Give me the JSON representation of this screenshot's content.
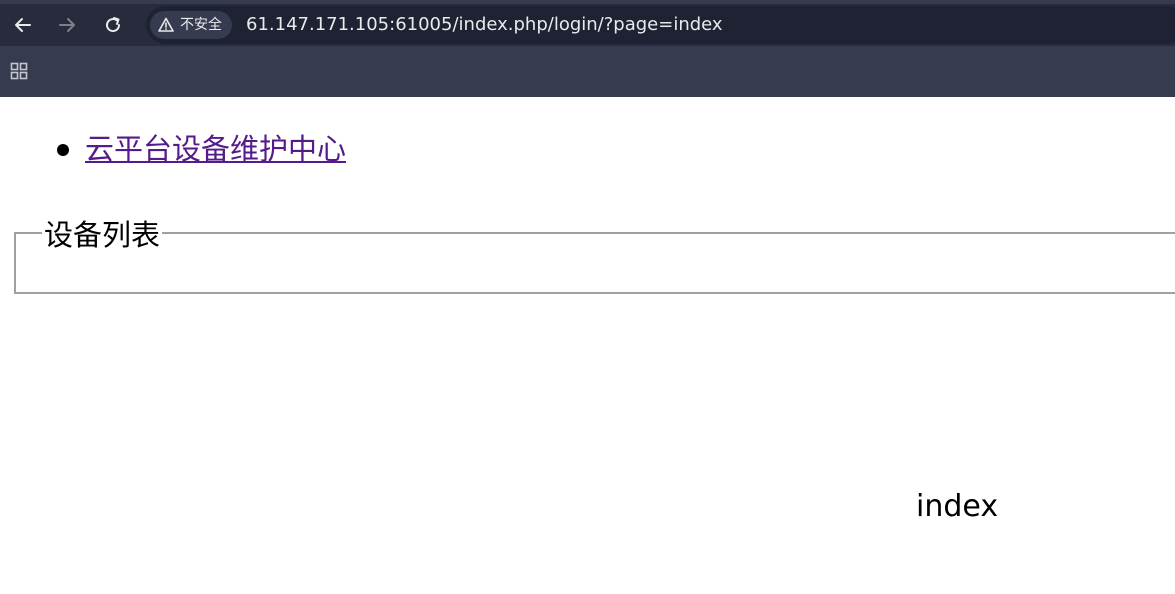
{
  "browser": {
    "security_label": "不安全",
    "url": "61.147.171.105:61005/index.php/login/?page=index",
    "icons": {
      "back": "arrow-left-icon",
      "forward": "arrow-right-icon",
      "reload": "reload-icon",
      "security": "warning-triangle-icon",
      "apps": "apps-grid-icon"
    },
    "colors": {
      "chrome_bg": "#363b4f",
      "toolbar_bg": "#272b3b",
      "omnibox_bg": "#1e2232",
      "text": "#e8eaed"
    }
  },
  "page": {
    "nav_links": [
      {
        "label": "云平台设备维护中心"
      }
    ],
    "device_list": {
      "legend": "设备列表"
    },
    "page_indicator": "index",
    "colors": {
      "link_visited": "#551a8b",
      "fieldset_border": "#a0a0a0"
    }
  }
}
